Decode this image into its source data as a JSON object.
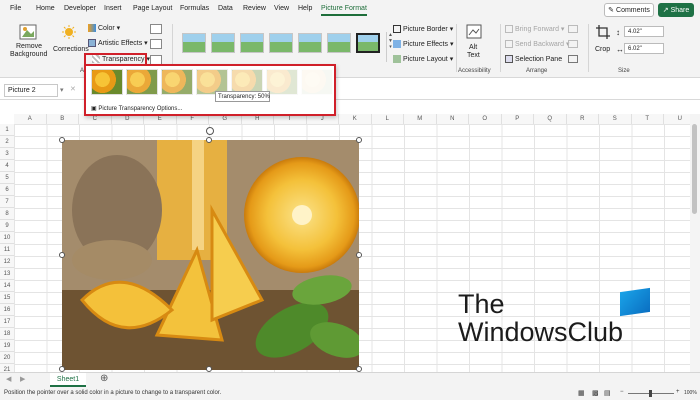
{
  "tabs": [
    "File",
    "Home",
    "Developer",
    "Insert",
    "Page Layout",
    "Formulas",
    "Data",
    "Review",
    "View",
    "Help",
    "Picture Format"
  ],
  "active_tab": "Picture Format",
  "comments_label": "Comments",
  "share_label": "Share",
  "ribbon": {
    "remove_bg_line1": "Remove",
    "remove_bg_line2": "Background",
    "corrections": "Corrections",
    "color": "Color",
    "artistic_effects": "Artistic Effects",
    "transparency": "Transparency",
    "adjust_group_partial": "Ad",
    "picture_border": "Picture Border",
    "picture_effects": "Picture Effects",
    "picture_layout": "Picture Layout",
    "alt_text_line1": "Alt",
    "alt_text_line2": "Text",
    "accessibility": "Accessibility",
    "bring_forward": "Bring Forward",
    "send_backward": "Send Backward",
    "selection_pane": "Selection Pane",
    "arrange": "Arrange",
    "crop": "Crop",
    "height": "4.02\"",
    "width": "6.02\"",
    "size": "Size"
  },
  "formula_bar": {
    "name_box": "Picture 2"
  },
  "dropdown": {
    "options_label": "Picture Transparency Options...",
    "tooltip": "Transparency: 50%",
    "swatch_opacities": [
      1,
      0.85,
      0.7,
      0.5,
      0.35,
      0.2,
      0.05
    ]
  },
  "columns": [
    "A",
    "B",
    "C",
    "D",
    "E",
    "F",
    "G",
    "H",
    "I",
    "J",
    "K",
    "L",
    "M",
    "N",
    "O",
    "P",
    "Q",
    "R",
    "S",
    "T",
    "U"
  ],
  "rows": [
    "1",
    "2",
    "3",
    "4",
    "5",
    "6",
    "7",
    "8",
    "9",
    "10",
    "11",
    "12",
    "13",
    "14",
    "15",
    "16",
    "17",
    "18",
    "19",
    "20",
    "21"
  ],
  "watermark": {
    "line1": "The",
    "line2": "WindowsClub"
  },
  "sheet_tab": "Sheet1",
  "status": {
    "message": "Position the pointer over a solid color in a picture to change to a transparent color.",
    "zoom": "100%"
  },
  "colors": {
    "accent": "#1e7145",
    "highlight": "#d0202a"
  }
}
